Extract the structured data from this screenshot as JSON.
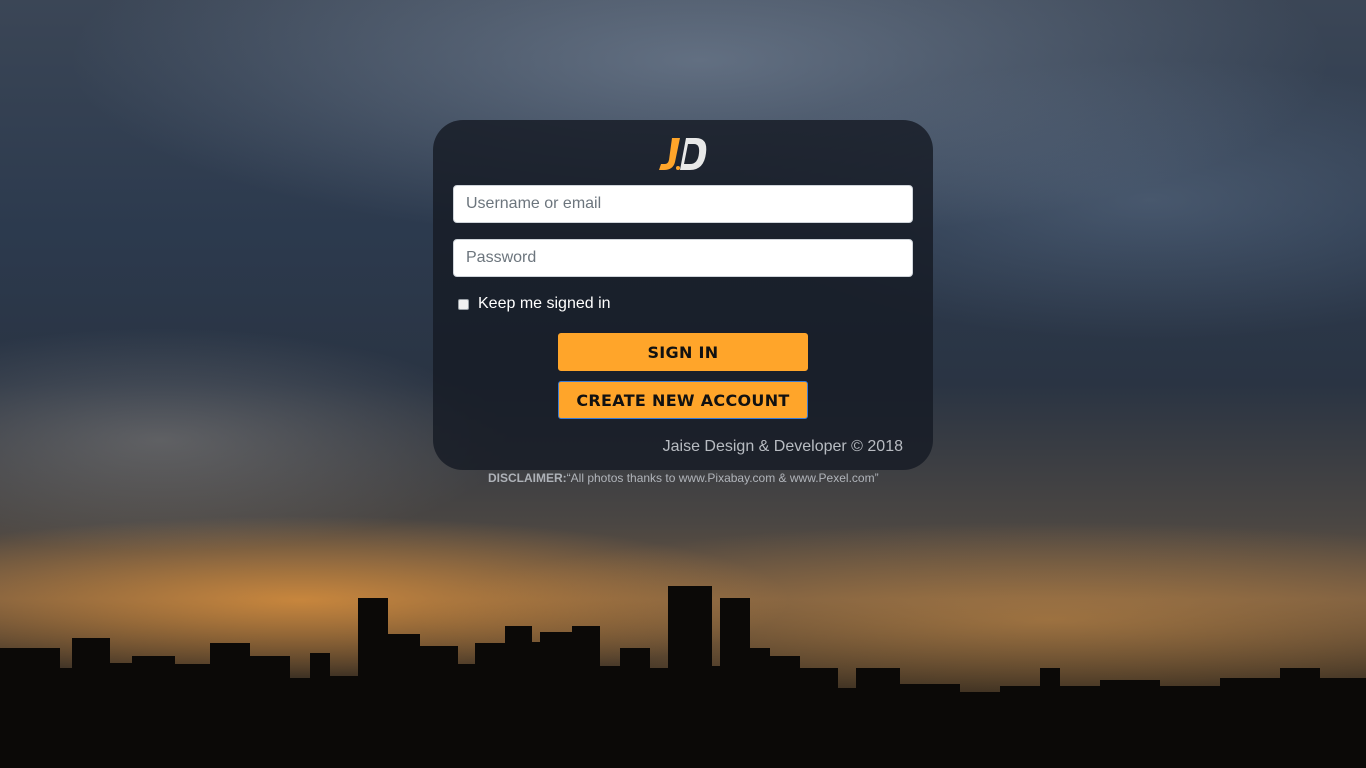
{
  "brand": {
    "logo_letters": "JD",
    "accent_color": "#ffa52a"
  },
  "login_form": {
    "username_placeholder": "Username or email",
    "password_placeholder": "Password",
    "remember_label": "Keep me signed in",
    "remember_checked": false,
    "sign_in_label": "SIGN IN",
    "create_account_label": "CREATE NEW ACCOUNT",
    "credit": "Jaise Design & Developer © 2018"
  },
  "disclaimer": {
    "label": "DISCLAIMER:",
    "text": "“All photos thanks to www.Pixabay.com & www.Pexel.com”"
  },
  "icons": {
    "logo": "jd-logo-icon",
    "checkbox": "checkbox-icon"
  }
}
